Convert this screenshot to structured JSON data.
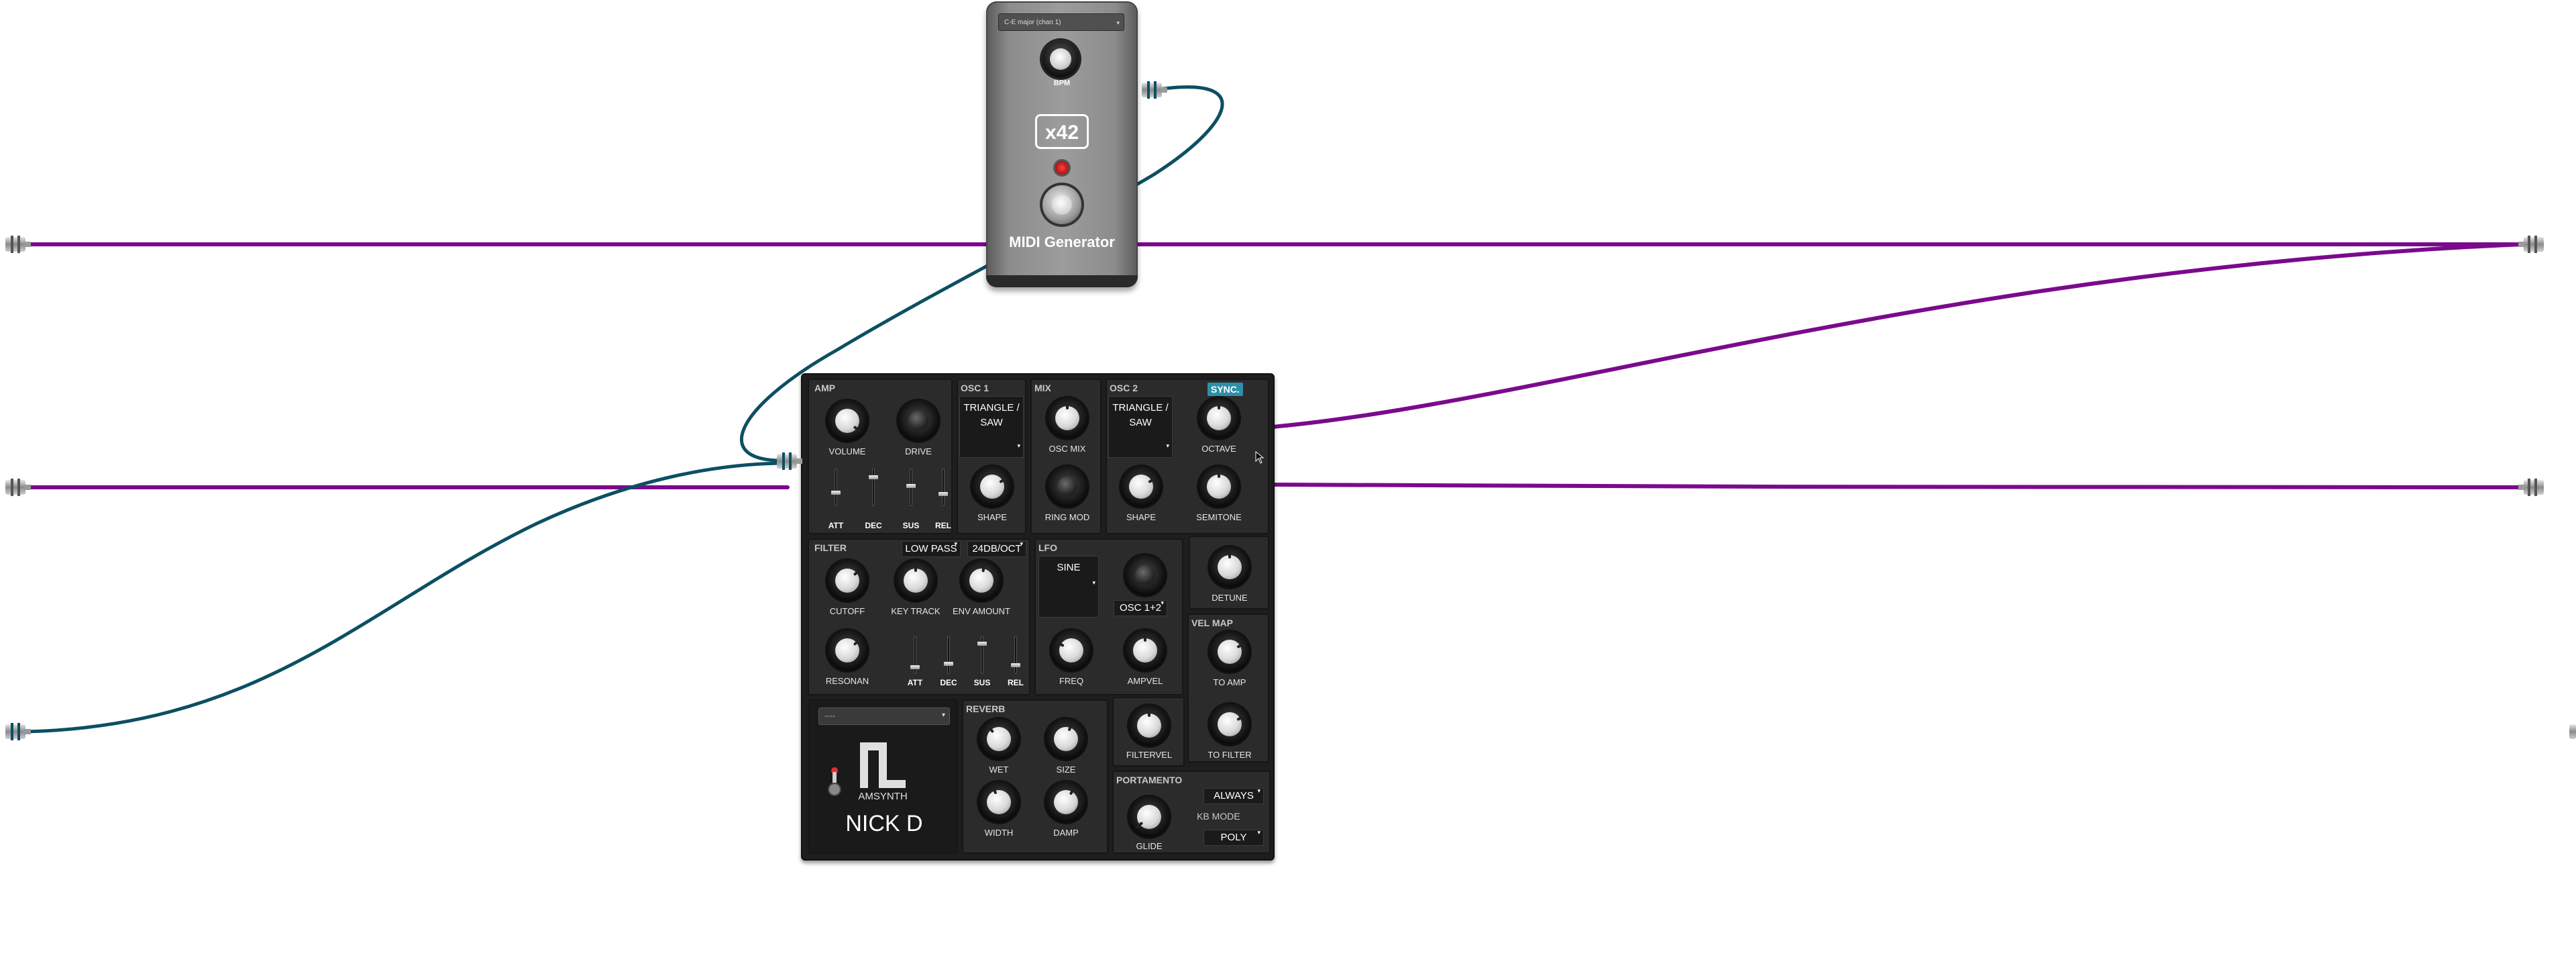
{
  "canvas": {
    "background": "#ffffff"
  },
  "colors": {
    "purple_cable": "#7a0a8c",
    "teal_cable": "#0d4f63"
  },
  "midi_generator": {
    "scale_select": "C-E major (chan 1)",
    "bpm_label": "BPM",
    "badge": "x42",
    "title": "MIDI Generator"
  },
  "synth": {
    "amp": {
      "header": "AMP",
      "volume_label": "VOLUME",
      "drive_label": "DRIVE",
      "env_labels": [
        "ATT",
        "DEC",
        "SUS",
        "REL"
      ],
      "env_levels": [
        0.35,
        0.8,
        0.55,
        0.3
      ]
    },
    "osc1": {
      "header": "OSC 1",
      "waveform": "TRIANGLE / SAW",
      "shape_label": "SHAPE"
    },
    "mix": {
      "header": "MIX",
      "oscmix_label": "OSC MIX",
      "ringmod_label": "RING MOD"
    },
    "osc2": {
      "header": "OSC 2",
      "sync_label": "SYNC.",
      "waveform": "TRIANGLE / SAW",
      "octave_label": "OCTAVE",
      "shape_label": "SHAPE",
      "semitone_label": "SEMITONE",
      "detune_label": "DETUNE"
    },
    "filter": {
      "header": "FILTER",
      "type": "LOW PASS",
      "slope": "24DB/OCT",
      "cutoff_label": "CUTOFF",
      "keytrack_label": "KEY TRACK",
      "envamount_label": "ENV AMOUNT",
      "resonance_label": "RESONAN",
      "env_labels": [
        "ATT",
        "DEC",
        "SUS",
        "REL"
      ],
      "env_levels": [
        0.15,
        0.25,
        0.85,
        0.2
      ]
    },
    "lfo": {
      "header": "LFO",
      "waveform": "SINE",
      "target": "OSC 1+2",
      "freq_label": "FREQ",
      "ampvel_label": "AMPVEL",
      "filtervel_label": "FILTERVEL"
    },
    "velmap": {
      "header": "VEL MAP",
      "toamp_label": "TO AMP",
      "tofilter_label": "TO FILTER"
    },
    "reverb": {
      "header": "REVERB",
      "wet_label": "WET",
      "size_label": "SIZE",
      "width_label": "WIDTH",
      "damp_label": "DAMP"
    },
    "portamento": {
      "header": "PORTAMENTO",
      "mode": "ALWAYS",
      "glide_label": "GLIDE"
    },
    "kbmode": {
      "header": "KB MODE",
      "value": "POLY"
    },
    "preset": {
      "selected": "----"
    },
    "brand": {
      "name": "AMSYNTH",
      "author": "NICK D"
    }
  }
}
